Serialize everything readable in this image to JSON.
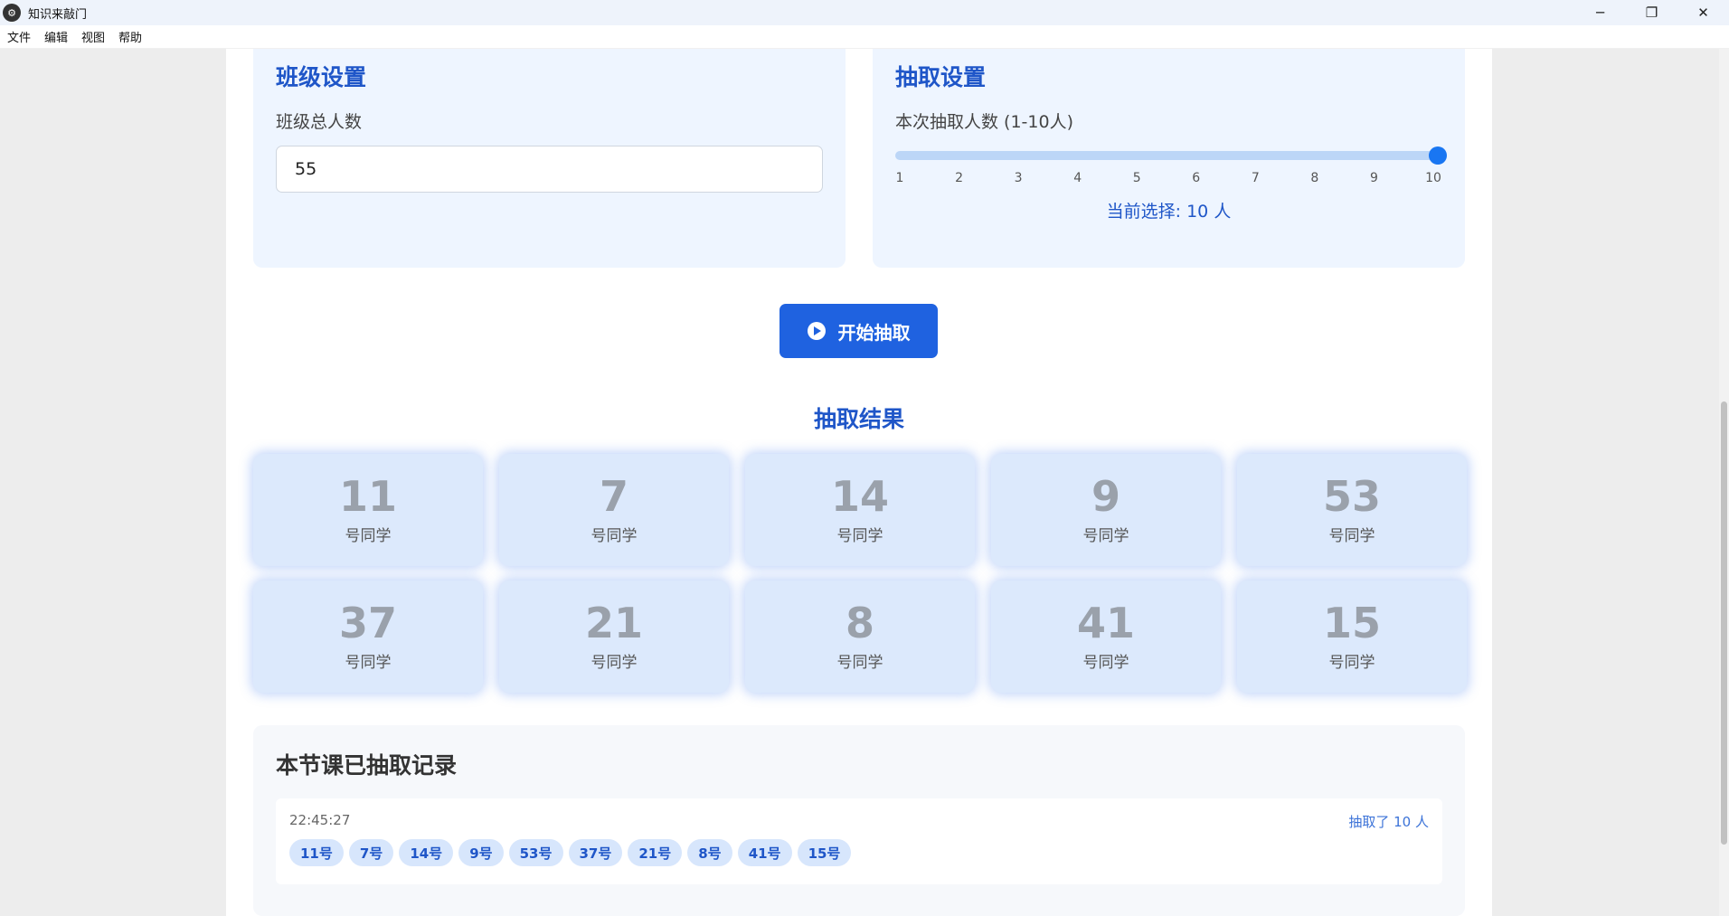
{
  "window": {
    "title": "知识来敲门",
    "controls": {
      "minimize": "─",
      "restore": "❐",
      "close": "✕"
    }
  },
  "menu": [
    "文件",
    "编辑",
    "视图",
    "帮助"
  ],
  "class_settings": {
    "title": "班级设置",
    "label": "班级总人数",
    "value": "55"
  },
  "draw_settings": {
    "title": "抽取设置",
    "label": "本次抽取人数 (1-10人)",
    "ticks": [
      "1",
      "2",
      "3",
      "4",
      "5",
      "6",
      "7",
      "8",
      "9",
      "10"
    ],
    "slider_value": 10,
    "slider_min": 1,
    "slider_max": 10,
    "current": "当前选择: 10 人"
  },
  "start_button": "开始抽取",
  "results": {
    "title": "抽取结果",
    "label": "号同学",
    "numbers": [
      "11",
      "7",
      "14",
      "9",
      "53",
      "37",
      "21",
      "8",
      "41",
      "15"
    ]
  },
  "history": {
    "title": "本节课已抽取记录",
    "records": [
      {
        "time": "22:45:27",
        "count": "抽取了 10 人",
        "chips": [
          "11号",
          "7号",
          "14号",
          "9号",
          "53号",
          "37号",
          "21号",
          "8号",
          "41号",
          "15号"
        ]
      }
    ]
  },
  "colors": {
    "accent": "#1f56c8",
    "button": "#1f62e0",
    "card": "#dce9fc",
    "panel": "#eef5ff"
  }
}
